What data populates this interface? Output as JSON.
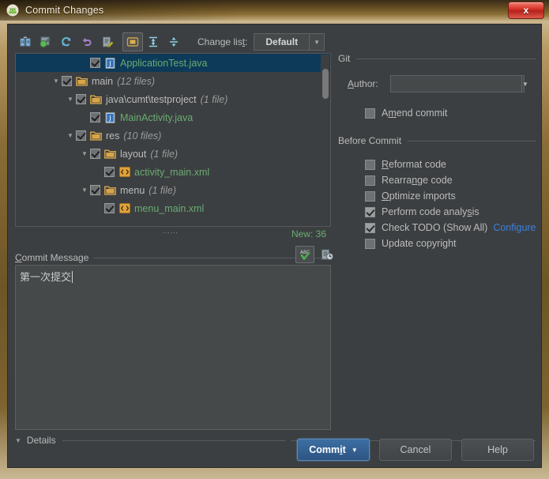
{
  "window": {
    "title": "Commit Changes",
    "app_icon": "android-studio-icon",
    "close_label": "x"
  },
  "toolbar": {
    "buttons": [
      {
        "name": "show-diff-icon",
        "label": ""
      },
      {
        "name": "revert-icon",
        "label": ""
      },
      {
        "name": "refresh-icon",
        "label": ""
      },
      {
        "name": "rollback-icon",
        "label": ""
      },
      {
        "name": "edit-source-icon",
        "label": ""
      },
      {
        "name": "group-by-directory-icon",
        "label": ""
      },
      {
        "name": "expand-all-icon",
        "label": ""
      },
      {
        "name": "collapse-all-icon",
        "label": ""
      }
    ],
    "changelist_label": "Change list:",
    "changelist_value": "Default",
    "dropdown_arrow": "▼"
  },
  "tree": {
    "rows": [
      {
        "indent": 4,
        "twisty": "",
        "checked": true,
        "icon": "java-file-icon",
        "label": "ApplicationTest.java",
        "count": "",
        "kind": "java",
        "selected": true
      },
      {
        "indent": 2,
        "twisty": "▼",
        "checked": true,
        "icon": "folder-icon",
        "label": "main",
        "count": "(12 files)",
        "kind": "folder",
        "selected": false
      },
      {
        "indent": 3,
        "twisty": "▼",
        "checked": true,
        "icon": "folder-icon",
        "label": "java\\cumt\\testproject",
        "count": "(1 file)",
        "kind": "folder",
        "selected": false
      },
      {
        "indent": 4,
        "twisty": "",
        "checked": true,
        "icon": "java-file-icon",
        "label": "MainActivity.java",
        "count": "",
        "kind": "java",
        "selected": false
      },
      {
        "indent": 3,
        "twisty": "▼",
        "checked": true,
        "icon": "folder-icon",
        "label": "res",
        "count": "(10 files)",
        "kind": "folder",
        "selected": false
      },
      {
        "indent": 4,
        "twisty": "▼",
        "checked": true,
        "icon": "folder-icon",
        "label": "layout",
        "count": "(1 file)",
        "kind": "folder",
        "selected": false
      },
      {
        "indent": 5,
        "twisty": "",
        "checked": true,
        "icon": "xml-file-icon",
        "label": "activity_main.xml",
        "count": "",
        "kind": "xml",
        "selected": false
      },
      {
        "indent": 4,
        "twisty": "▼",
        "checked": true,
        "icon": "folder-icon",
        "label": "menu",
        "count": "(1 file)",
        "kind": "folder",
        "selected": false
      },
      {
        "indent": 5,
        "twisty": "",
        "checked": true,
        "icon": "xml-file-icon",
        "label": "menu_main.xml",
        "count": "",
        "kind": "xml",
        "selected": false
      }
    ],
    "new_count": "New: 36",
    "splitter_dots": "⋯⋯"
  },
  "commit_message": {
    "label_prefix": "C",
    "label_rest": "ommit Message",
    "text": "第一次提交",
    "spellcheck_icon": "abc-spellcheck-icon",
    "history_icon": "message-history-icon"
  },
  "details": {
    "twisty": "▼",
    "label": "Details",
    "dots": "⋯⋯"
  },
  "git": {
    "group_title": "Git",
    "author_label_prefix": "A",
    "author_label_rest": "uthor:",
    "author_value": "",
    "author_placeholder": "",
    "dropdown_arrow": "▼",
    "amend": {
      "label_prefix": "A",
      "label_underline": "m",
      "label_rest": "end commit",
      "checked": false
    }
  },
  "before_commit": {
    "group_title": "Before Commit",
    "items": [
      {
        "prefix": "",
        "underline": "R",
        "rest": "eformat code",
        "checked": false,
        "name": "reformat-code"
      },
      {
        "prefix": "Rearra",
        "underline": "n",
        "rest": "ge code",
        "checked": false,
        "name": "rearrange-code"
      },
      {
        "prefix": "",
        "underline": "O",
        "rest": "ptimize imports",
        "checked": false,
        "name": "optimize-imports"
      },
      {
        "prefix": "Perform code analy",
        "underline": "s",
        "rest": "is",
        "checked": true,
        "name": "perform-code-analysis"
      },
      {
        "prefix": "Check TODO (Show All)",
        "underline": "",
        "rest": "",
        "checked": true,
        "name": "check-todo"
      },
      {
        "prefix": "Update copyright",
        "underline": "",
        "rest": "",
        "checked": false,
        "name": "update-copyright"
      }
    ],
    "configure_link": "Configure"
  },
  "buttons": {
    "commit": {
      "prefix": "Comm",
      "underline": "i",
      "rest": "t",
      "arrow": "▼"
    },
    "cancel": "Cancel",
    "help": "Help"
  }
}
